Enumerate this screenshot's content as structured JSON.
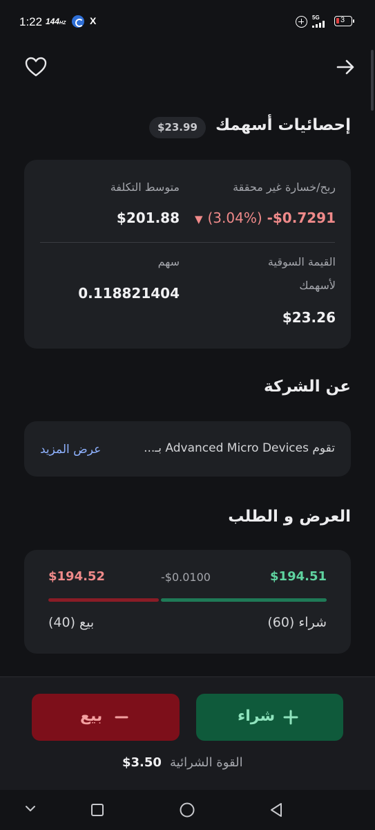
{
  "status_bar": {
    "time": "1:22",
    "refresh_rate": "144",
    "refresh_unit": "HZ",
    "x_label": "X",
    "network": "5G",
    "battery": "3"
  },
  "header": {
    "favorite_icon": "heart-icon",
    "back_icon": "arrow-right-icon"
  },
  "stats": {
    "title": "إحصائيات أسهمك",
    "price_badge": "$23.99",
    "unrealized_label": "ربح/خسارة غير محققة",
    "unrealized_value": "-$0.7291",
    "unrealized_percent": "(3.04%)",
    "down_arrow": "▼",
    "avg_cost_label": "متوسط التكلفة",
    "avg_cost_value": "$201.88",
    "market_value_label_line1": "القيمة السوقية",
    "market_value_label_line2": "لأسهمك",
    "market_value_value": "$23.26",
    "shares_label": "سهم",
    "shares_value": "0.118821404"
  },
  "about": {
    "title": "عن الشركة",
    "text": "تقوم Advanced Micro Devices بـ...",
    "more_label": "عرض المزيد"
  },
  "order_book": {
    "title": "العرض و الطلب",
    "bid_price": "$194.51",
    "spread": "-$0.0100",
    "ask_price": "$194.52",
    "buy_count_label": "شراء (60)",
    "sell_count_label": "بيع (40)",
    "bid_fraction": 0.6,
    "colors": {
      "bid": "#1f7a57",
      "ask": "#8a1c26"
    }
  },
  "actions": {
    "buy_label": "شراء",
    "sell_label": "بيع",
    "buy_icon": "plus-icon",
    "sell_icon": "minus-icon",
    "buying_power_label": "القوة الشرائية",
    "buying_power_value": "$3.50"
  },
  "colors": {
    "background": "#121316",
    "card": "#1e2024",
    "buy": "#0f5a3b",
    "sell": "#7d0f1a",
    "positive": "#5fd3a0",
    "negative": "#f08a8a",
    "link": "#8fb2ff"
  }
}
